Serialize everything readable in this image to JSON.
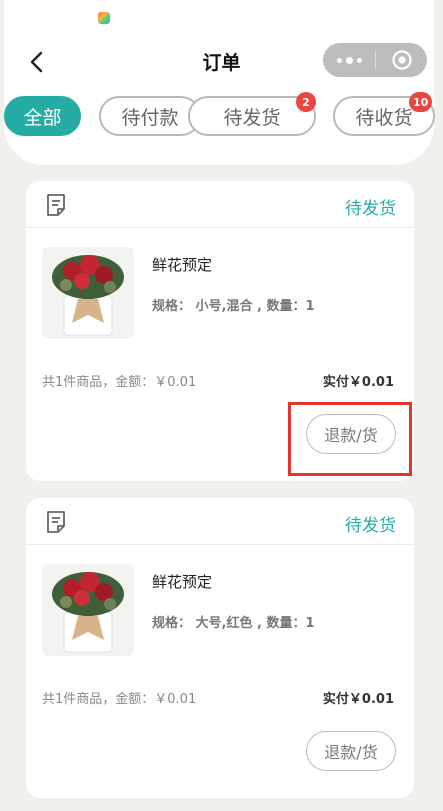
{
  "header": {
    "title": "订单",
    "back_icon": "chevron-left-icon",
    "capsule": {
      "more_icon": "more-dots-icon",
      "close_icon": "target-circle-icon"
    }
  },
  "tabs": [
    {
      "label": "全部",
      "active": true,
      "badge": null
    },
    {
      "label": "待付款",
      "active": false,
      "badge": null
    },
    {
      "label": "待发货",
      "active": false,
      "badge": "2"
    },
    {
      "label": "待收货",
      "active": false,
      "badge": "10"
    }
  ],
  "colors": {
    "accent": "#25aca4",
    "badge": "#e8463f",
    "highlight": "#e0342d"
  },
  "orders": [
    {
      "status": "待发货",
      "product_name": "鲜花预定",
      "spec": "规格： 小号,混合 , 数量：1",
      "summary": "共1件商品，金额：￥0.01",
      "paid": "实付￥0.01",
      "refund_label": "退款/货",
      "highlighted": true
    },
    {
      "status": "待发货",
      "product_name": "鲜花预定",
      "spec": "规格： 大号,红色 , 数量：1",
      "summary": "共1件商品，金额：￥0.01",
      "paid": "实付￥0.01",
      "refund_label": "退款/货",
      "highlighted": false
    }
  ]
}
